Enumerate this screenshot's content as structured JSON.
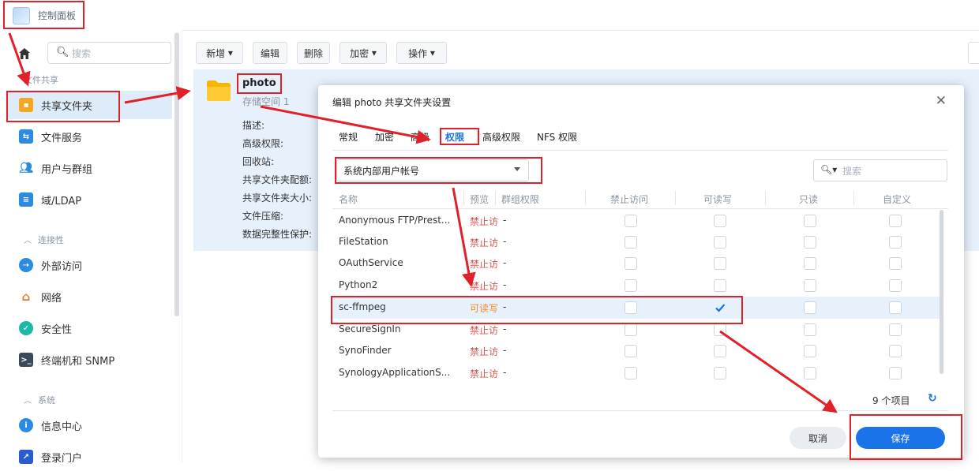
{
  "app": {
    "title": "控制面板",
    "icon": "control-panel-icon"
  },
  "sidebar": {
    "search_placeholder": "搜索",
    "sections": {
      "file_sharing": "文件共享",
      "connectivity": "连接性",
      "system": "系统"
    },
    "items": [
      {
        "label": "共享文件夹",
        "icon": "shared-folder-icon",
        "active": true
      },
      {
        "label": "文件服务",
        "icon": "file-services-icon"
      },
      {
        "label": "用户与群组",
        "icon": "users-groups-icon"
      },
      {
        "label": "域/LDAP",
        "icon": "domain-ldap-icon"
      },
      {
        "label": "外部访问",
        "icon": "external-access-icon"
      },
      {
        "label": "网络",
        "icon": "network-icon"
      },
      {
        "label": "安全性",
        "icon": "security-icon"
      },
      {
        "label": "终端机和 SNMP",
        "icon": "terminal-snmp-icon"
      },
      {
        "label": "信息中心",
        "icon": "info-center-icon"
      },
      {
        "label": "登录门户",
        "icon": "login-portal-icon"
      }
    ]
  },
  "toolbar": {
    "new": "新增",
    "edit": "编辑",
    "delete": "删除",
    "encrypt": "加密",
    "action": "操作"
  },
  "folder": {
    "name": "photo",
    "subtitle": "存储空间 1",
    "props": [
      "描述:",
      "高级权限:",
      "回收站:",
      "共享文件夹配额:",
      "共享文件夹大小:",
      "文件压缩:",
      "数据完整性保护:"
    ]
  },
  "dialog": {
    "title": "编辑 photo 共享文件夹设置",
    "tabs": [
      "常规",
      "加密",
      "高级",
      "权限",
      "高级权限",
      "NFS 权限"
    ],
    "active_tab": "权限",
    "user_type_value": "系统内部用户帐号",
    "search_placeholder": "搜索",
    "columns": [
      "名称",
      "预览",
      "群组权限",
      "禁止访问",
      "可读写",
      "只读",
      "自定义"
    ],
    "rows": [
      {
        "name": "Anonymous FTP/Prest...",
        "preview": "禁止访",
        "group": "-",
        "rw": false
      },
      {
        "name": "FileStation",
        "preview": "禁止访",
        "group": "-",
        "rw": false
      },
      {
        "name": "OAuthService",
        "preview": "禁止访",
        "group": "-",
        "rw": false
      },
      {
        "name": "Python2",
        "preview": "禁止访",
        "group": "-",
        "rw": false
      },
      {
        "name": "sc-ffmpeg",
        "preview": "可读写",
        "group": "-",
        "rw": true
      },
      {
        "name": "SecureSignIn",
        "preview": "禁止访",
        "group": "-",
        "rw": false
      },
      {
        "name": "SynoFinder",
        "preview": "禁止访",
        "group": "-",
        "rw": false
      },
      {
        "name": "SynologyApplicationS...",
        "preview": "禁止访",
        "group": "-",
        "rw": false
      }
    ],
    "item_count": "9 个项目",
    "cancel": "取消",
    "save": "保存"
  },
  "colors": {
    "accent": "#1a73e8",
    "annotation": "#e0202a",
    "deny": "#d9534f",
    "readwrite": "#f08a24"
  }
}
